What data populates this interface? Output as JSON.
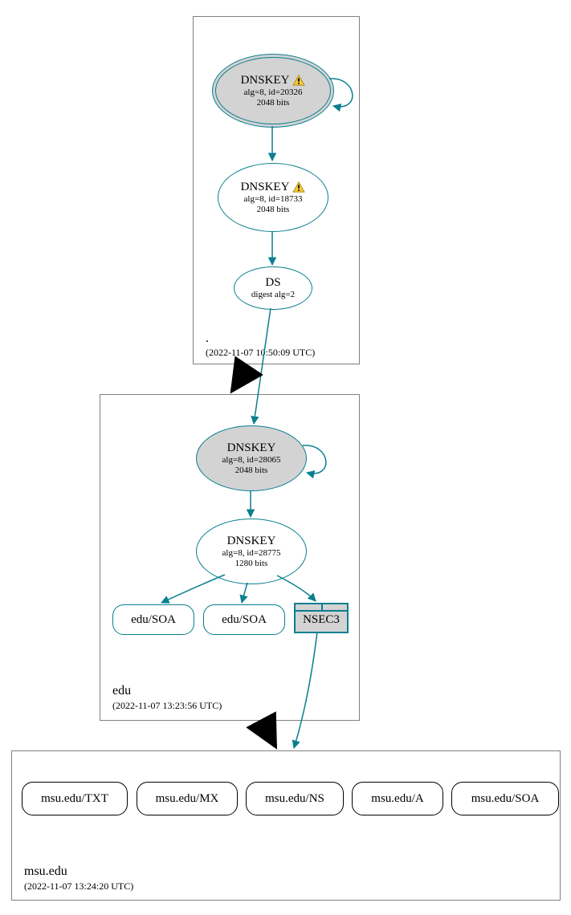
{
  "zones": {
    "root": {
      "name": ".",
      "time": "(2022-11-07 10:50:09 UTC)",
      "dnskey1": {
        "title": "DNSKEY",
        "sub1": "alg=8, id=20326",
        "sub2": "2048 bits",
        "warn": true
      },
      "dnskey2": {
        "title": "DNSKEY",
        "sub1": "alg=8, id=18733",
        "sub2": "2048 bits",
        "warn": true
      },
      "ds": {
        "title": "DS",
        "sub1": "digest alg=2"
      }
    },
    "edu": {
      "name": "edu",
      "time": "(2022-11-07 13:23:56 UTC)",
      "dnskey1": {
        "title": "DNSKEY",
        "sub1": "alg=8, id=28065",
        "sub2": "2048 bits"
      },
      "dnskey2": {
        "title": "DNSKEY",
        "sub1": "alg=8, id=28775",
        "sub2": "1280 bits"
      },
      "soa1": "edu/SOA",
      "soa2": "edu/SOA",
      "nsec3": "NSEC3"
    },
    "msu": {
      "name": "msu.edu",
      "time": "(2022-11-07 13:24:20 UTC)",
      "records": {
        "txt": "msu.edu/TXT",
        "mx": "msu.edu/MX",
        "ns": "msu.edu/NS",
        "a": "msu.edu/A",
        "soa": "msu.edu/SOA"
      }
    }
  }
}
